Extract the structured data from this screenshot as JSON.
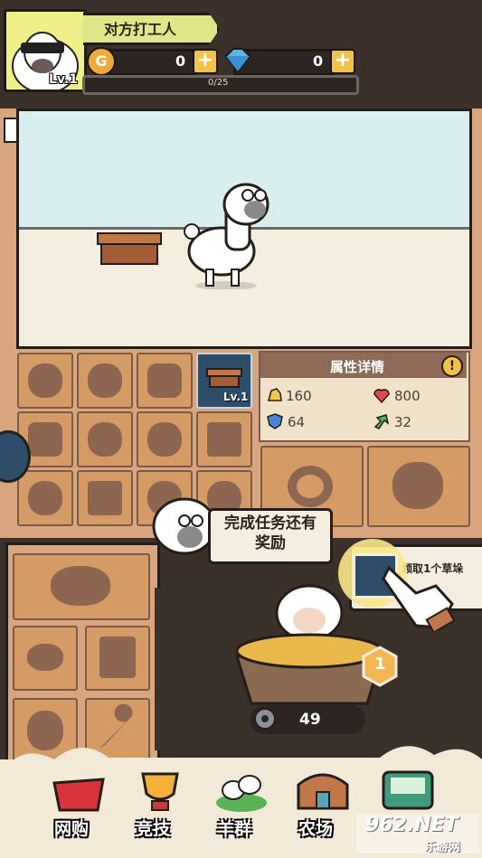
{
  "player": {
    "name": "对方打工人",
    "level_label": "Lv.1",
    "gold": "0",
    "gems": "0",
    "exp_text": "0/25",
    "exp_progress": 0
  },
  "inventory": {
    "equipped_level_label": "Lv.1"
  },
  "attributes": {
    "title": "属性详情",
    "attack": "160",
    "health": "800",
    "defense": "64",
    "speed": "32"
  },
  "tip": {
    "text": "完成任务还有奖励",
    "quest_text": "领取1个草垛"
  },
  "farm": {
    "badge": "1",
    "count": "49"
  },
  "nav": {
    "shop": "网购",
    "arena": "竞技",
    "flock": "羊群",
    "farm": "农场"
  },
  "watermark": {
    "logo": "962.NET",
    "sub": "乐游网"
  },
  "colors": {
    "accent_yellow": "#f3c24a",
    "panel_brown": "#d8a57e",
    "slot_brown": "#d59b67",
    "dark_outline": "#241d19"
  }
}
